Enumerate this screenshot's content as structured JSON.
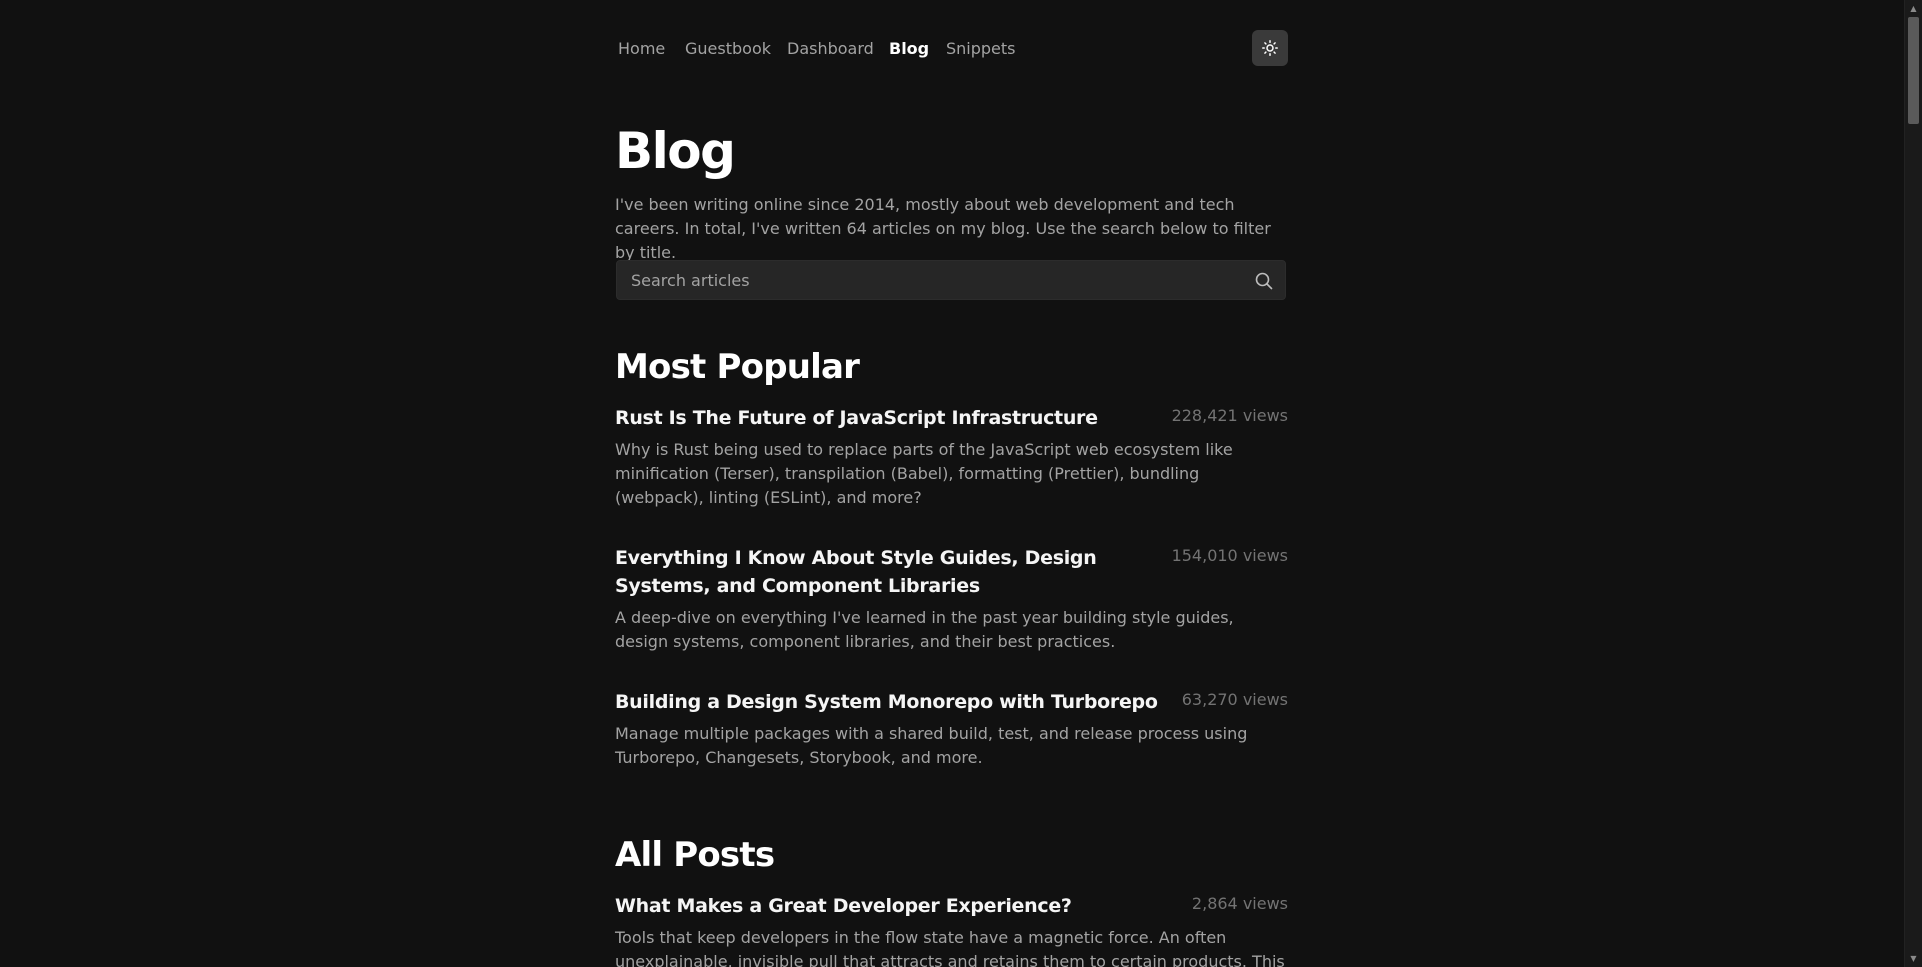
{
  "nav": {
    "items": [
      {
        "label": "Home"
      },
      {
        "label": "Guestbook"
      },
      {
        "label": "Dashboard"
      },
      {
        "label": "Blog"
      },
      {
        "label": "Snippets"
      }
    ],
    "active": "Blog",
    "theme_toggle_icon": "sun-icon"
  },
  "page": {
    "title": "Blog",
    "intro": "I've been writing online since 2014, mostly about web development and tech careers. In total, I've written 64 articles on my blog. Use the search below to filter by title."
  },
  "search": {
    "placeholder": "Search articles",
    "value": "",
    "icon": "search-icon"
  },
  "most_popular": {
    "heading": "Most Popular",
    "posts": [
      {
        "title": "Rust Is The Future of JavaScript Infrastructure",
        "views": "228,421 views",
        "description": "Why is Rust being used to replace parts of the JavaScript web ecosystem like minification (Terser), transpilation (Babel), formatting (Prettier), bundling (webpack), linting (ESLint), and more?"
      },
      {
        "title": "Everything I Know About Style Guides, Design Systems, and Component Libraries",
        "views": "154,010 views",
        "description": "A deep-dive on everything I've learned in the past year building style guides, design systems, component libraries, and their best practices."
      },
      {
        "title": "Building a Design System Monorepo with Turborepo",
        "views": "63,270 views",
        "description": "Manage multiple packages with a shared build, test, and release process using Turborepo, Changesets, Storybook, and more."
      }
    ]
  },
  "all_posts": {
    "heading": "All Posts",
    "posts": [
      {
        "title": "What Makes a Great Developer Experience?",
        "views": "2,864 views",
        "description": "Tools that keep developers in the flow state have a magnetic force. An often unexplainable, invisible pull that attracts and retains them to certain products. This pull is Developer"
      }
    ]
  },
  "colors": {
    "background": "#111111",
    "text_primary": "#ffffff",
    "text_secondary": "#a3a3a3",
    "text_muted": "#737373",
    "search_bg": "#262626",
    "toggle_bg": "#3a3a3a"
  }
}
